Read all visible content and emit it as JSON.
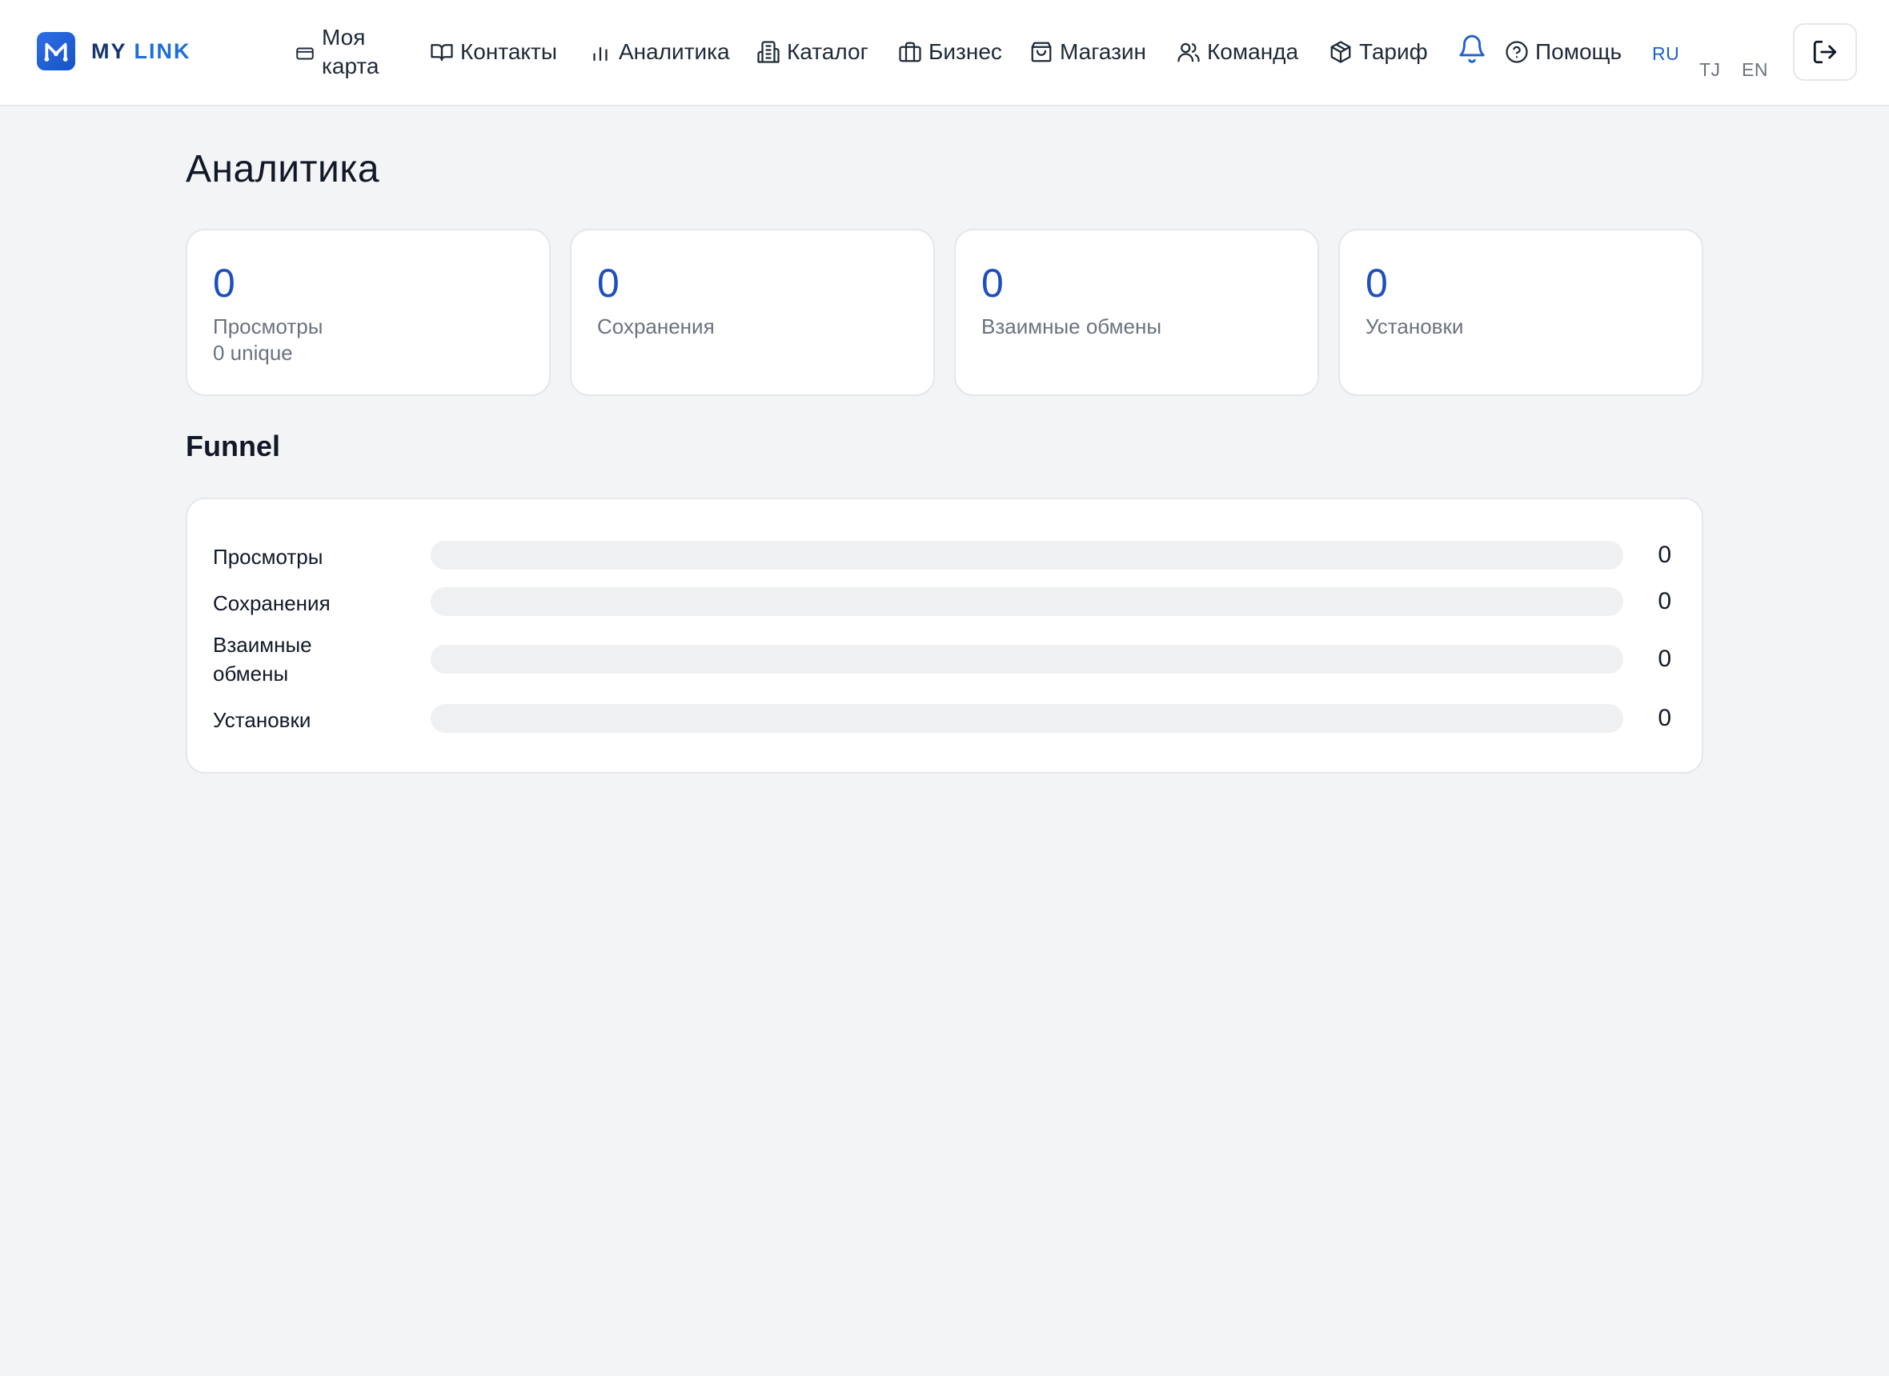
{
  "brand": {
    "name_part1": "MY ",
    "name_part2": "LINK"
  },
  "nav": {
    "my_card": "Моя карта",
    "contacts": "Контакты",
    "analytics": "Аналитика",
    "catalog": "Каталог",
    "business": "Бизнес",
    "shop": "Магазин",
    "team": "Команда",
    "tariff": "Тариф",
    "help": "Помощь"
  },
  "languages": {
    "ru": "RU",
    "tj": "TJ",
    "en": "EN",
    "active": "RU"
  },
  "page": {
    "title": "Аналитика"
  },
  "stats": {
    "views": {
      "value": "0",
      "label": "Просмотры",
      "sub": "0 unique"
    },
    "saves": {
      "value": "0",
      "label": "Сохранения"
    },
    "exchanges": {
      "value": "0",
      "label": "Взаимные обмены"
    },
    "installs": {
      "value": "0",
      "label": "Установки"
    }
  },
  "funnel": {
    "title": "Funnel",
    "rows": [
      {
        "label": "Просмотры",
        "value": "0",
        "fraction": 0
      },
      {
        "label": "Сохранения",
        "value": "0",
        "fraction": 0
      },
      {
        "label": "Взаимные обмены",
        "value": "0",
        "fraction": 0
      },
      {
        "label": "Установки",
        "value": "0",
        "fraction": 0
      }
    ]
  },
  "icons": {
    "logo": "mylink-logo-icon",
    "my_card": "card-icon",
    "contacts": "book-icon",
    "analytics": "bar-chart-icon",
    "catalog": "building-icon",
    "business": "briefcase-icon",
    "shop": "shopping-bag-icon",
    "team": "users-icon",
    "tariff": "box-icon",
    "notifications": "bell-icon",
    "help": "help-circle-icon",
    "logout": "logout-icon"
  },
  "colors": {
    "accent": "#1d5fcf",
    "stat_value": "#1d4fbf",
    "page_bg": "#f3f4f6",
    "track": "#eef0f2"
  }
}
